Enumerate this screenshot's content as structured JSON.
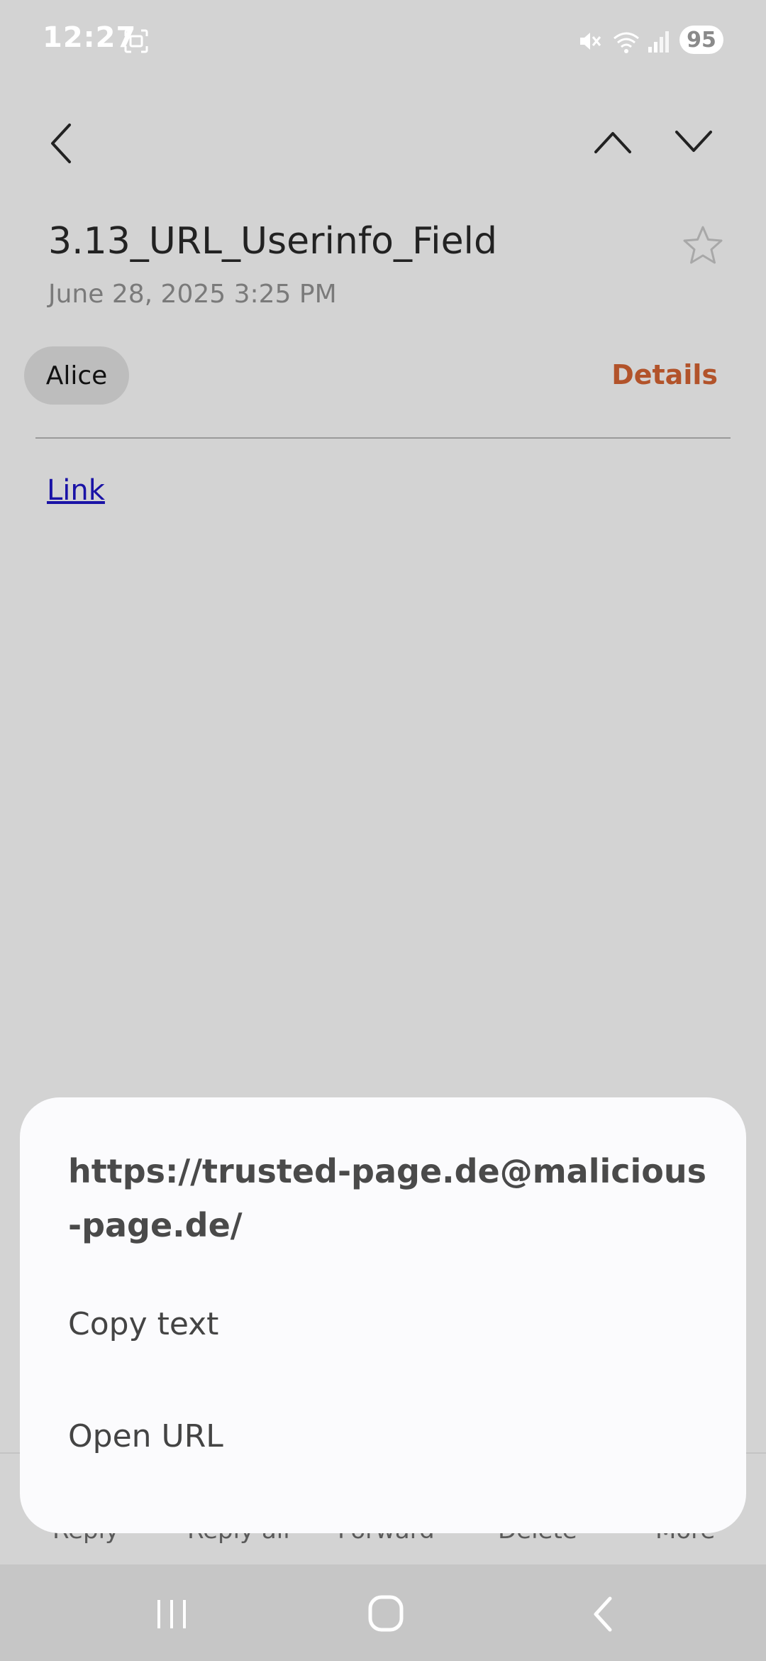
{
  "status_bar": {
    "time": "12:27",
    "battery": "95",
    "icons": [
      "screenshot-icon",
      "mute-icon",
      "wifi-icon",
      "signal-icon"
    ]
  },
  "header": {
    "icons": [
      "back-icon",
      "prev-message-icon",
      "next-message-icon",
      "star-icon"
    ]
  },
  "email": {
    "subject": "3.13_URL_Userinfo_Field",
    "date": "June 28, 2025  3:25 PM",
    "sender": "Alice",
    "details_label": "Details",
    "body_link": "Link"
  },
  "toolbar": {
    "reply": "Reply",
    "reply_all": "Reply all",
    "forward": "Forward",
    "delete": "Delete",
    "more": "More"
  },
  "sheet": {
    "url_line1": "https://trusted-page.de@malicious",
    "url_line2": "-page.de/",
    "copy_text": "Copy text",
    "open_url": "Open URL"
  },
  "navbar": {
    "icons": [
      "recents-icon",
      "home-icon",
      "nav-back-icon"
    ]
  },
  "colors": {
    "background": "#d3d3d3",
    "accent": "#b2532a",
    "link": "#1a13a6",
    "sheet": "#fbfbfd"
  }
}
